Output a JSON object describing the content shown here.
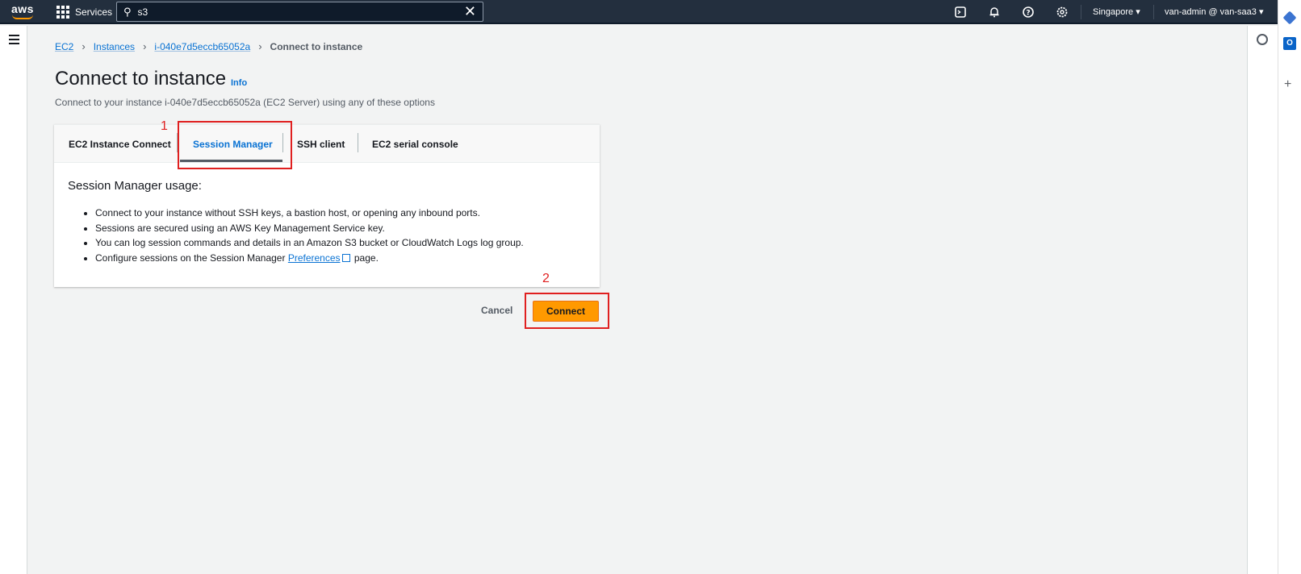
{
  "topnav": {
    "logo": "aws",
    "services_label": "Services",
    "search_value": "s3",
    "region": "Singapore ▾",
    "account": "van-admin @ van-saa3 ▾",
    "icons": [
      "cloudshell-icon",
      "notifications-icon",
      "help-icon",
      "settings-icon"
    ]
  },
  "breadcrumb": {
    "items": [
      "EC2",
      "Instances",
      "i-040e7d5eccb65052a"
    ],
    "current": "Connect to instance"
  },
  "page": {
    "title": "Connect to instance",
    "info_link": "Info",
    "subtitle": "Connect to your instance i-040e7d5eccb65052a (EC2 Server) using any of these options"
  },
  "tabs": [
    {
      "label": "EC2 Instance Connect"
    },
    {
      "label": "Session Manager",
      "active": true
    },
    {
      "label": "SSH client"
    },
    {
      "label": "EC2 serial console"
    }
  ],
  "session_manager": {
    "heading": "Session Manager usage:",
    "bullets": [
      "Connect to your instance without SSH keys, a bastion host, or opening any inbound ports.",
      "Sessions are secured using an AWS Key Management Service key.",
      "You can log session commands and details in an Amazon S3 bucket or CloudWatch Logs log group."
    ],
    "last_bullet_prefix": "Configure sessions on the Session Manager",
    "last_bullet_link": "Preferences",
    "last_bullet_suffix": "page."
  },
  "actions": {
    "cancel": "Cancel",
    "connect": "Connect"
  },
  "annotations": [
    "1",
    "2"
  ],
  "colors": {
    "nav_bg": "#232f3e",
    "accent_orange": "#ff9900",
    "link_blue": "#0972d3",
    "annotation_red": "#e02020"
  }
}
